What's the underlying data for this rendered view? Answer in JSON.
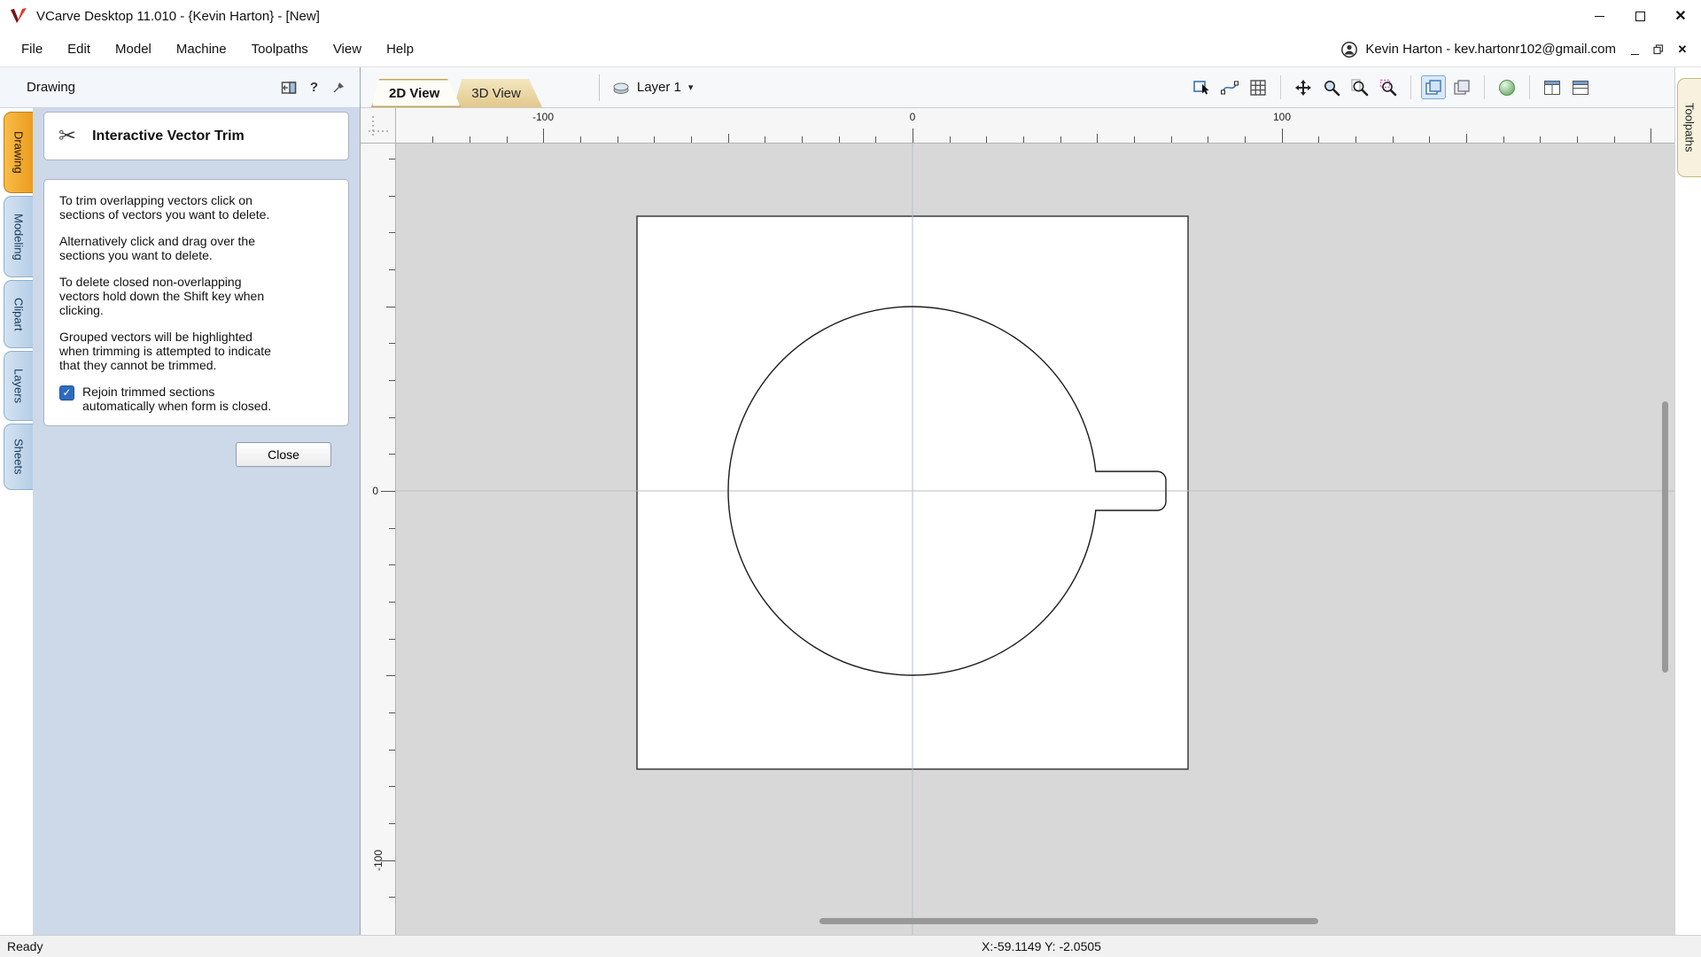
{
  "titlebar": {
    "title": "VCarve Desktop 11.010 - {Kevin Harton} - [New]"
  },
  "menubar": {
    "items": [
      "File",
      "Edit",
      "Model",
      "Machine",
      "Toolpaths",
      "View",
      "Help"
    ],
    "account": "Kevin Harton - kev.hartonr102@gmail.com"
  },
  "panel": {
    "header": "Drawing",
    "tool_title": "Interactive Vector Trim",
    "paragraphs": [
      "To trim overlapping vectors click on sections of vectors you want to delete.",
      "Alternatively click and drag over the sections you want to delete.",
      "To delete closed non-overlapping vectors hold down the Shift key when clicking.",
      "Grouped vectors will be highlighted when trimming is attempted to indicate that they cannot be trimmed."
    ],
    "checkbox_label": "Rejoin trimmed sections automatically when form is closed.",
    "checkbox_checked": true,
    "close_label": "Close"
  },
  "left_tabs": [
    "Drawing",
    "Modeling",
    "Clipart",
    "Layers",
    "Sheets"
  ],
  "right_tabs": [
    "Toolpaths"
  ],
  "view": {
    "tabs": [
      "2D View",
      "3D View"
    ],
    "active_tab": "2D View",
    "layer": "Layer 1"
  },
  "ruler": {
    "h_labels": [
      "-100",
      "0",
      "100"
    ],
    "v_labels": [
      "0",
      "-100"
    ]
  },
  "canvas": {
    "shapes": [
      "square material boundary",
      "circle with rounded rectangular tab slot on right side",
      "gray datum crosshair at X0 Y0"
    ]
  },
  "statusbar": {
    "ready": "Ready",
    "coords": "X:-59.1149 Y: -2.0505"
  },
  "icons": {
    "close": "✕",
    "help": "?",
    "scissors": "✂",
    "check": "✓",
    "caret": "▾",
    "names": [
      "vcarve-logo",
      "window-minimize",
      "window-maximize",
      "window-close",
      "account-person",
      "mdi-minimize",
      "mdi-restore",
      "mdi-close",
      "dock-panel",
      "help",
      "pin-panel",
      "scissors",
      "layer-disc",
      "caret-down",
      "select-vectors",
      "node-edit",
      "snap-grid",
      "pan-view",
      "zoom-interactive",
      "zoom-to-drawing",
      "zoom-to-selection",
      "toggle-2d-toolpath-drawing",
      "toggle-solid-toolpath-drawing",
      "rotate-3d-view",
      "tile-windows-horizontal",
      "tile-windows-vertical",
      "xy-datum-corner"
    ]
  }
}
